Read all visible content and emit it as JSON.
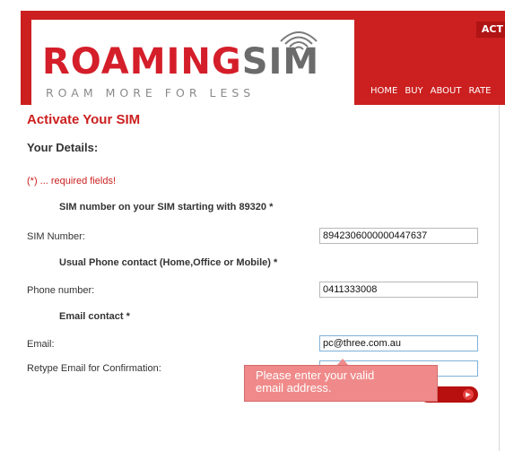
{
  "brand": {
    "name_part1": "ROAMING",
    "name_part2": "SIM",
    "tagline": "ROAM MORE FOR LESS",
    "colors": {
      "red": "#cc1f1f",
      "gray": "#6b6b6b"
    }
  },
  "header": {
    "act_label": "ACT",
    "nav": [
      "HOME",
      "BUY",
      "ABOUT",
      "RATE"
    ]
  },
  "form": {
    "title": "Activate Your SIM",
    "section": "Your Details:",
    "required_note": "(*) ... required fields!",
    "sim_group": "SIM number on your SIM starting with 89320 *",
    "sim_label": "SIM Number:",
    "sim_value": "8942306000000447637",
    "phone_group": "Usual Phone contact (Home,Office or Mobile) *",
    "phone_label": "Phone number:",
    "phone_value": "0411333008",
    "email_group": "Email contact *",
    "email_label": "Email:",
    "email_value": "pc@three.com.au",
    "retype_label": "Retype Email for Confirmation:",
    "retype_value": ""
  },
  "tooltip": {
    "line1": "Please enter your valid",
    "line2": "email address."
  }
}
